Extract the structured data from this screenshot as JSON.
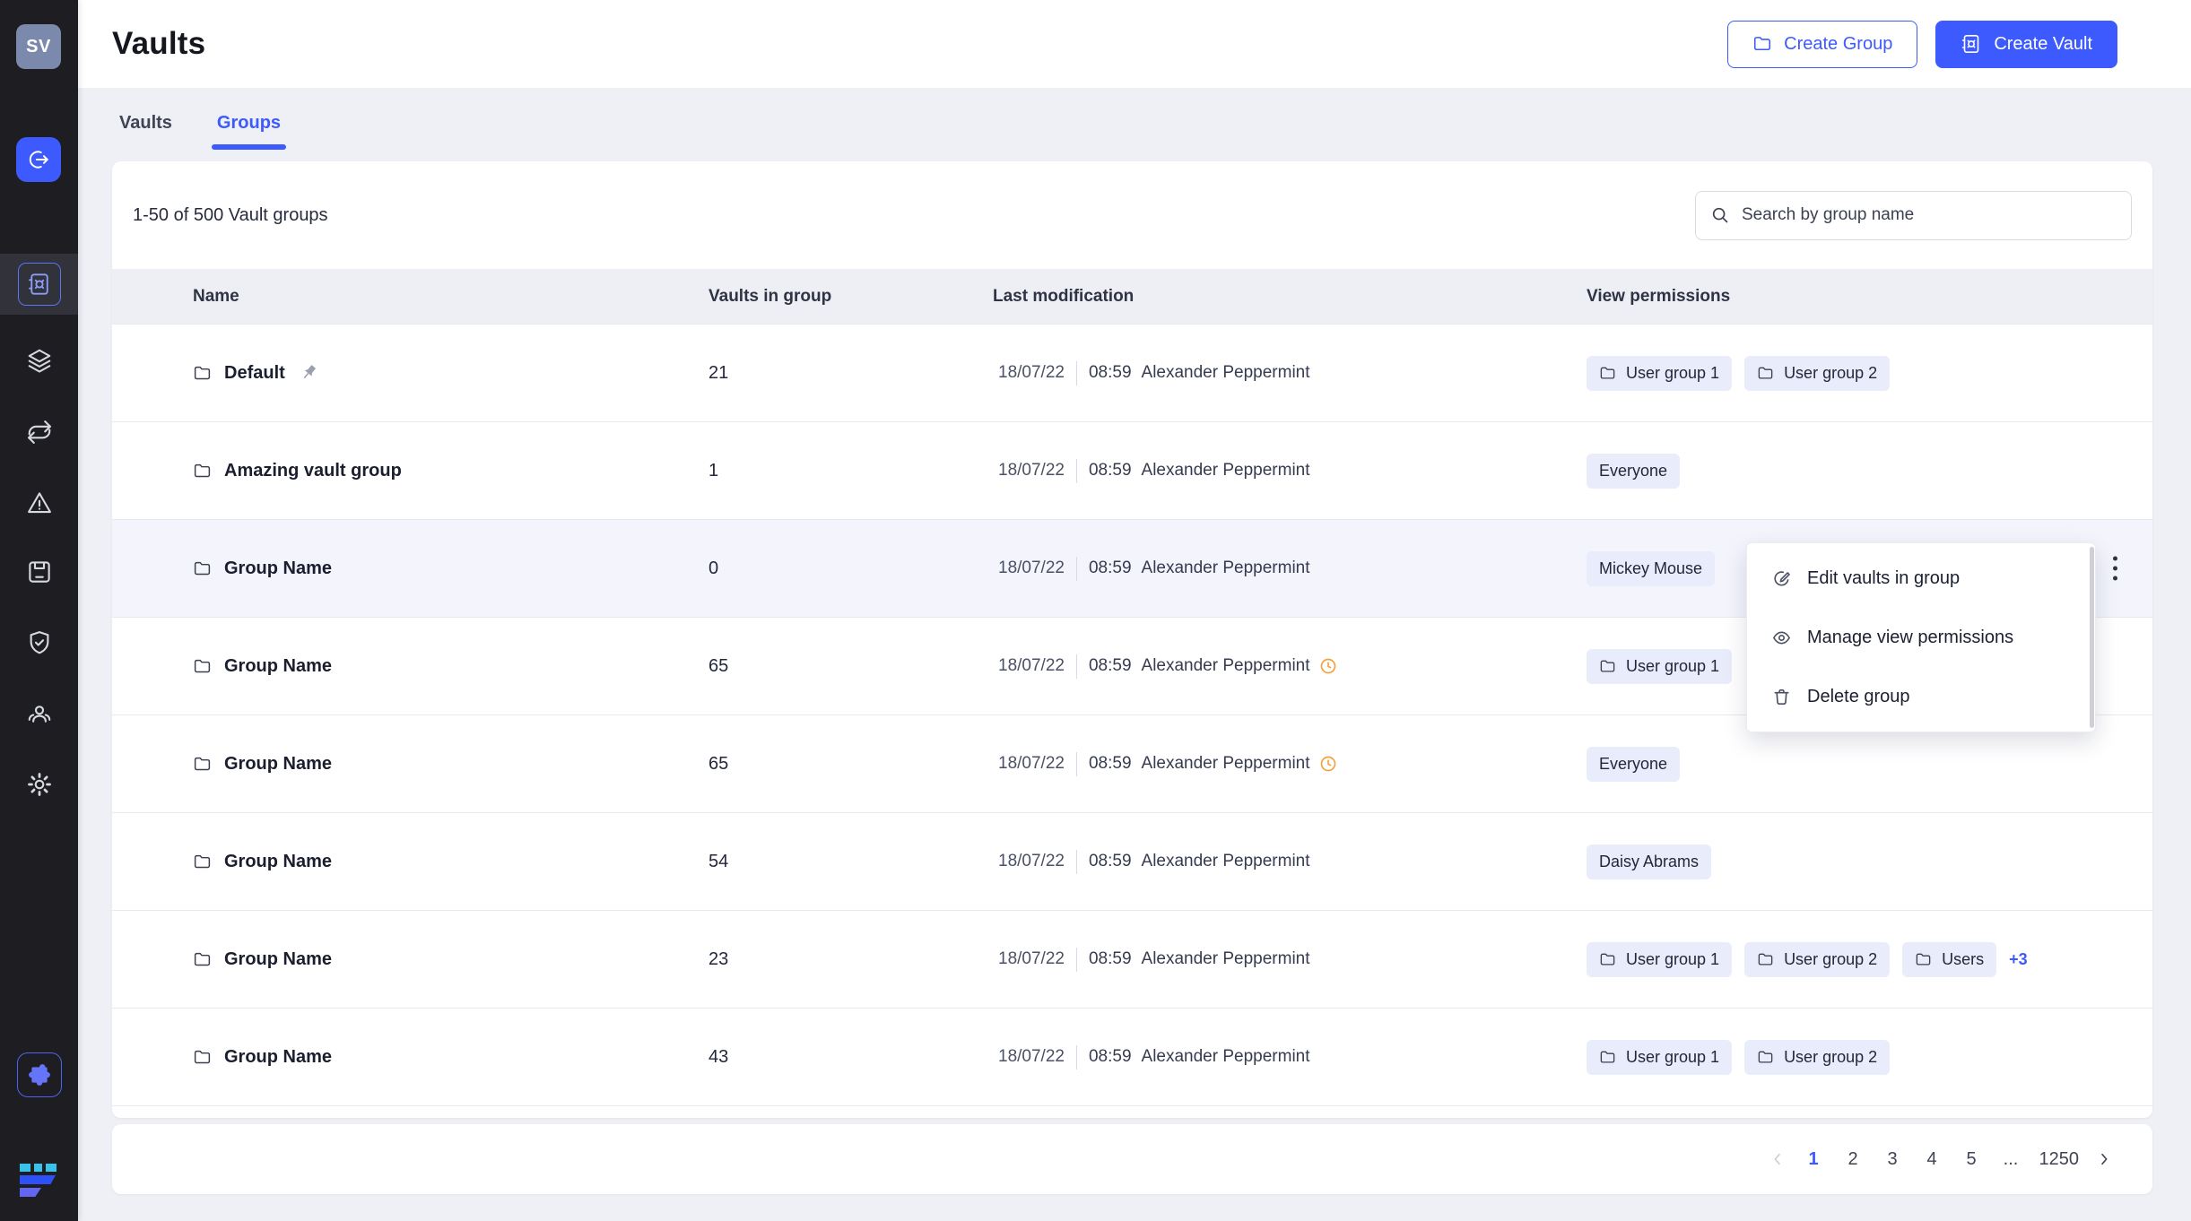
{
  "app": {
    "avatar_initials": "SV"
  },
  "header": {
    "title": "Vaults",
    "create_group_label": "Create Group",
    "create_vault_label": "Create Vault"
  },
  "tabs": [
    {
      "label": "Vaults",
      "active": false
    },
    {
      "label": "Groups",
      "active": true
    }
  ],
  "toolbar": {
    "count_text": "1-50 of 500 Vault groups",
    "search_placeholder": "Search by group name"
  },
  "table": {
    "columns": [
      "Name",
      "Vaults in group",
      "Last modification",
      "View permissions"
    ],
    "rows": [
      {
        "name": "Default",
        "pinned": true,
        "vaults": "21",
        "date": "18/07/22",
        "time": "08:59",
        "user": "Alexander Peppermint",
        "late": false,
        "highlighted": false,
        "kebab": false,
        "extra": "",
        "permissions": [
          {
            "label": "User group 1",
            "folder": true
          },
          {
            "label": "User group 2",
            "folder": true
          }
        ]
      },
      {
        "name": "Amazing vault group",
        "pinned": false,
        "vaults": "1",
        "date": "18/07/22",
        "time": "08:59",
        "user": "Alexander Peppermint",
        "late": false,
        "highlighted": false,
        "kebab": false,
        "extra": "",
        "permissions": [
          {
            "label": "Everyone",
            "folder": false
          }
        ]
      },
      {
        "name": "Group Name",
        "pinned": false,
        "vaults": "0",
        "date": "18/07/22",
        "time": "08:59",
        "user": "Alexander Peppermint",
        "late": false,
        "highlighted": true,
        "kebab": true,
        "extra": "",
        "permissions": [
          {
            "label": "Mickey Mouse",
            "folder": false
          }
        ]
      },
      {
        "name": "Group Name",
        "pinned": false,
        "vaults": "65",
        "date": "18/07/22",
        "time": "08:59",
        "user": "Alexander Peppermint",
        "late": true,
        "highlighted": false,
        "kebab": false,
        "extra": "",
        "permissions": [
          {
            "label": "User group 1",
            "folder": true
          }
        ]
      },
      {
        "name": "Group Name",
        "pinned": false,
        "vaults": "65",
        "date": "18/07/22",
        "time": "08:59",
        "user": "Alexander Peppermint",
        "late": true,
        "highlighted": false,
        "kebab": false,
        "extra": "",
        "permissions": [
          {
            "label": "Everyone",
            "folder": false
          }
        ]
      },
      {
        "name": "Group Name",
        "pinned": false,
        "vaults": "54",
        "date": "18/07/22",
        "time": "08:59",
        "user": "Alexander Peppermint",
        "late": false,
        "highlighted": false,
        "kebab": false,
        "extra": "",
        "permissions": [
          {
            "label": "Daisy Abrams",
            "folder": false
          }
        ]
      },
      {
        "name": "Group Name",
        "pinned": false,
        "vaults": "23",
        "date": "18/07/22",
        "time": "08:59",
        "user": "Alexander Peppermint",
        "late": false,
        "highlighted": false,
        "kebab": false,
        "extra": "+3",
        "permissions": [
          {
            "label": "User group 1",
            "folder": true
          },
          {
            "label": "User group 2",
            "folder": true
          },
          {
            "label": "Users",
            "folder": true
          }
        ]
      },
      {
        "name": "Group Name",
        "pinned": false,
        "vaults": "43",
        "date": "18/07/22",
        "time": "08:59",
        "user": "Alexander Peppermint",
        "late": false,
        "highlighted": false,
        "kebab": false,
        "extra": "",
        "permissions": [
          {
            "label": "User group 1",
            "folder": true
          },
          {
            "label": "User group 2",
            "folder": true
          }
        ]
      }
    ]
  },
  "context_menu": {
    "items": [
      {
        "icon": "edit-icon",
        "label": "Edit vaults in group"
      },
      {
        "icon": "eye-icon",
        "label": "Manage view permissions"
      },
      {
        "icon": "trash-icon",
        "label": "Delete group"
      }
    ]
  },
  "pagination": {
    "pages": [
      {
        "label": "1",
        "current": true
      },
      {
        "label": "2",
        "current": false
      },
      {
        "label": "3",
        "current": false
      },
      {
        "label": "4",
        "current": false
      },
      {
        "label": "5",
        "current": false
      },
      {
        "label": "...",
        "current": false
      },
      {
        "label": "1250",
        "current": false
      }
    ]
  },
  "icons": {
    "sidebar": [
      "logout-icon",
      "vault-icon",
      "layers-icon",
      "repeat-icon",
      "warning-icon",
      "archive-icon",
      "shield-check-icon",
      "users-icon",
      "gear-icon",
      "puzzle-icon",
      "brand-logo"
    ],
    "other": [
      "folder-icon",
      "pin-icon",
      "clock-icon",
      "search-icon",
      "kebab-icon",
      "edit-icon",
      "eye-icon",
      "trash-icon",
      "chevron-left-icon",
      "chevron-right-icon"
    ]
  },
  "colors": {
    "accent": "#3d5afe",
    "sidebar_bg": "#1d1d22",
    "page_bg": "#eef0f5",
    "chip_bg": "#e9ecfa",
    "late_clock": "#f0a23c",
    "highlight_row": "#f3f4fc"
  }
}
